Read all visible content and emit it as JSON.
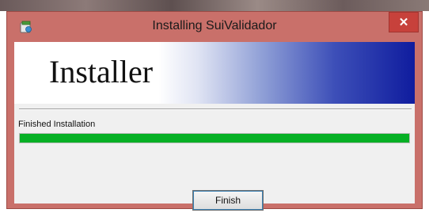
{
  "window": {
    "title": "Installing SuiValidador",
    "close_label": "✕",
    "app_icon": "installer-app-icon"
  },
  "banner": {
    "title": "Installer"
  },
  "status": {
    "text": "Finished Installation"
  },
  "progress": {
    "percent": 100
  },
  "buttons": {
    "finish_label": "Finish"
  },
  "colors": {
    "titlebar": "#c9706a",
    "close_button": "#c7413b",
    "progress_fill": "#06b025",
    "banner_gradient_end": "#0f1c9e"
  }
}
